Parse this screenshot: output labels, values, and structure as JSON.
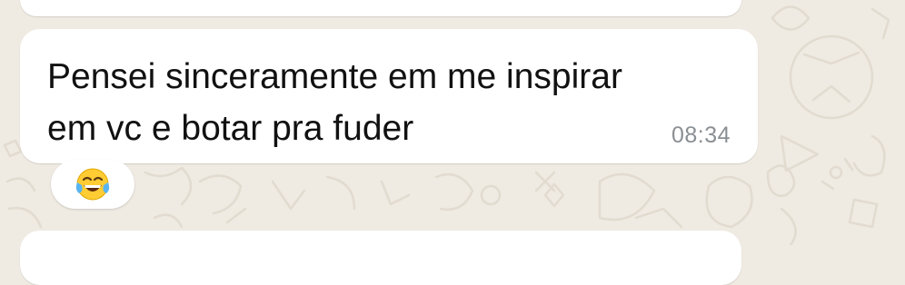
{
  "message": {
    "text": "Pensei sinceramente em me inspirar\nem vc e botar pra fuder",
    "time": "08:34"
  },
  "reaction": {
    "emoji_icon": "face-with-tears-of-joy-icon"
  },
  "colors": {
    "background": "#efeae2",
    "bubble": "#ffffff",
    "text": "#111111",
    "timestamp": "#8a8f94",
    "emoji_face": "#ffcc33",
    "emoji_tears": "#5ab4f0"
  }
}
